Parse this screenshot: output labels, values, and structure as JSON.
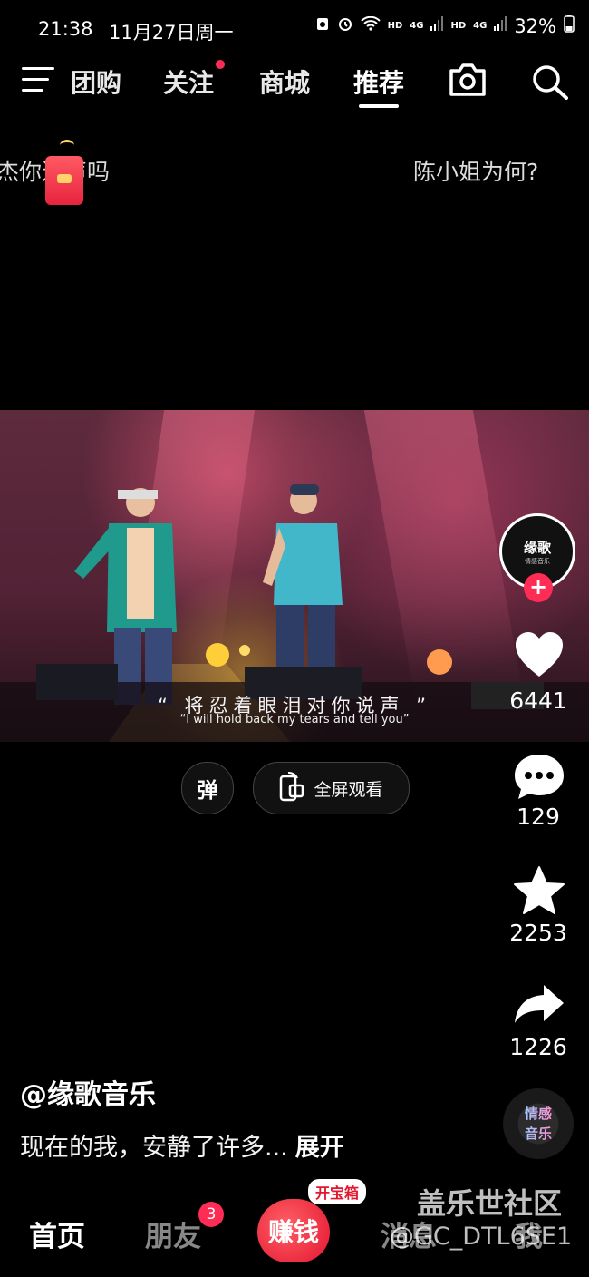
{
  "status_bar": {
    "time": "21:38",
    "date": "11月27日周一",
    "network1": "HD",
    "network2": "4G",
    "network3": "HD",
    "network4": "4G",
    "battery": "32%"
  },
  "top_nav": {
    "tabs": [
      {
        "label": "团购"
      },
      {
        "label": "关注"
      },
      {
        "label": "商城"
      },
      {
        "label": "推荐"
      }
    ],
    "active_tab": "推荐"
  },
  "trending": {
    "left": "杰你追声吗",
    "right": "陈小姐为何?"
  },
  "video": {
    "lyric_cn": "“ 将忍着眼泪对你说声 ”",
    "lyric_en": "“I will hold back my tears and tell you”"
  },
  "video_controls": {
    "danmu": "弹",
    "fullscreen": "全屏观看"
  },
  "creator_avatar": {
    "title": "缘歌",
    "subtitle": "情感音乐"
  },
  "actions": {
    "likes": "6441",
    "comments": "129",
    "favorites": "2253",
    "shares": "1226"
  },
  "music_disc": [
    "情感",
    "音乐"
  ],
  "post": {
    "author": "@缘歌音乐",
    "caption": "现在的我，安静了许多...",
    "expand": "展开"
  },
  "bottom_tabs": {
    "home": "首页",
    "friends": "朋友",
    "friends_badge": "3",
    "earn": "赚钱",
    "chest": "开宝箱",
    "messages": "消息",
    "me": "我"
  },
  "watermark": {
    "line1": "盖乐世社区",
    "line2": "@GC_DTL6SE1"
  },
  "colors": {
    "accent": "#ff2c55",
    "background": "#000000"
  }
}
